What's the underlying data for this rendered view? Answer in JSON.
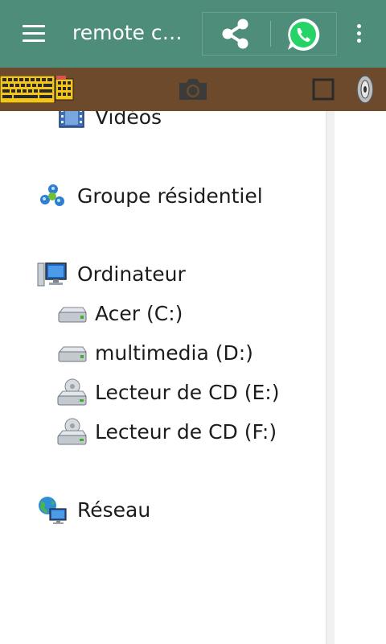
{
  "app_bar": {
    "title": "remote c…",
    "menu_icon": "hamburger-menu-icon",
    "share_icon": "share-icon",
    "whatsapp_icon": "whatsapp-icon",
    "overflow_icon": "more-vert-icon",
    "colors": {
      "background": "#4e8d79",
      "whatsapp": "#25d366"
    }
  },
  "toolbar": {
    "keyboard_icon": "keyboard-icon",
    "camera_icon": "camera-icon",
    "square_icon": "stop-square-icon",
    "volume_icon": "speaker-icon",
    "colors": {
      "background": "#6d4a2c",
      "keyboard": "#f5c518"
    }
  },
  "explorer": {
    "items": [
      {
        "label": "Vidéos",
        "icon": "video-library-icon"
      },
      {
        "label": "Groupe résidentiel",
        "icon": "homegroup-icon"
      },
      {
        "label": "Ordinateur",
        "icon": "computer-icon"
      },
      {
        "label": "Acer (C:)",
        "icon": "hard-drive-icon"
      },
      {
        "label": "multimedia (D:)",
        "icon": "hard-drive-icon"
      },
      {
        "label": "Lecteur de CD (E:)",
        "icon": "cd-drive-icon"
      },
      {
        "label": "Lecteur de CD (F:)",
        "icon": "cd-drive-icon"
      },
      {
        "label": "Réseau",
        "icon": "network-icon"
      }
    ]
  }
}
